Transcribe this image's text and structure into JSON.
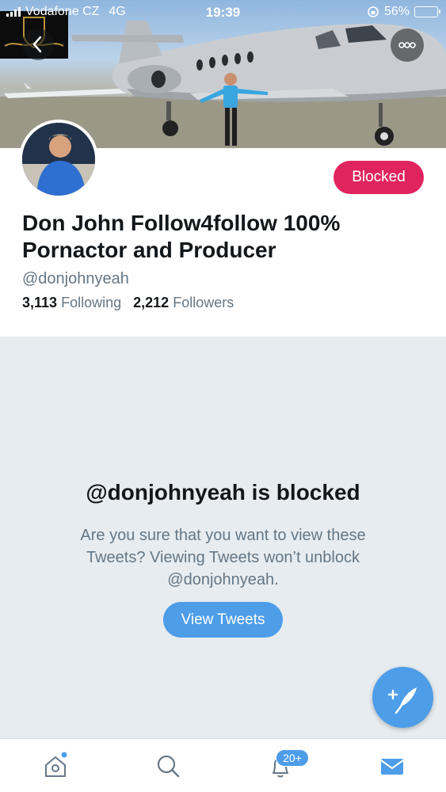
{
  "status_bar": {
    "carrier": "Vodafone CZ",
    "network": "4G",
    "time": "19:39",
    "battery_percent": "56%",
    "battery_level": 0.56
  },
  "header": {
    "back_icon": "chevron-left-icon",
    "more_icon": "ellipsis-icon"
  },
  "profile": {
    "blocked_label": "Blocked",
    "display_name": "Don John Follow4follow 100% Pornactor and Producer",
    "handle": "@donjohnyeah",
    "following_count": "3,113",
    "following_label": "Following",
    "followers_count": "2,212",
    "followers_label": "Followers"
  },
  "blocked_notice": {
    "title": "@donjohnyeah is blocked",
    "body": "Are you sure that you want to view these Tweets? Viewing Tweets won’t unblock @donjohnyeah.",
    "button_label": "View Tweets"
  },
  "tab_bar": {
    "notifications_badge": "20+"
  },
  "colors": {
    "accent": "#4d9de9",
    "blocked": "#e0245e",
    "secondary_text": "#657786",
    "background": "#e6ecf0"
  }
}
